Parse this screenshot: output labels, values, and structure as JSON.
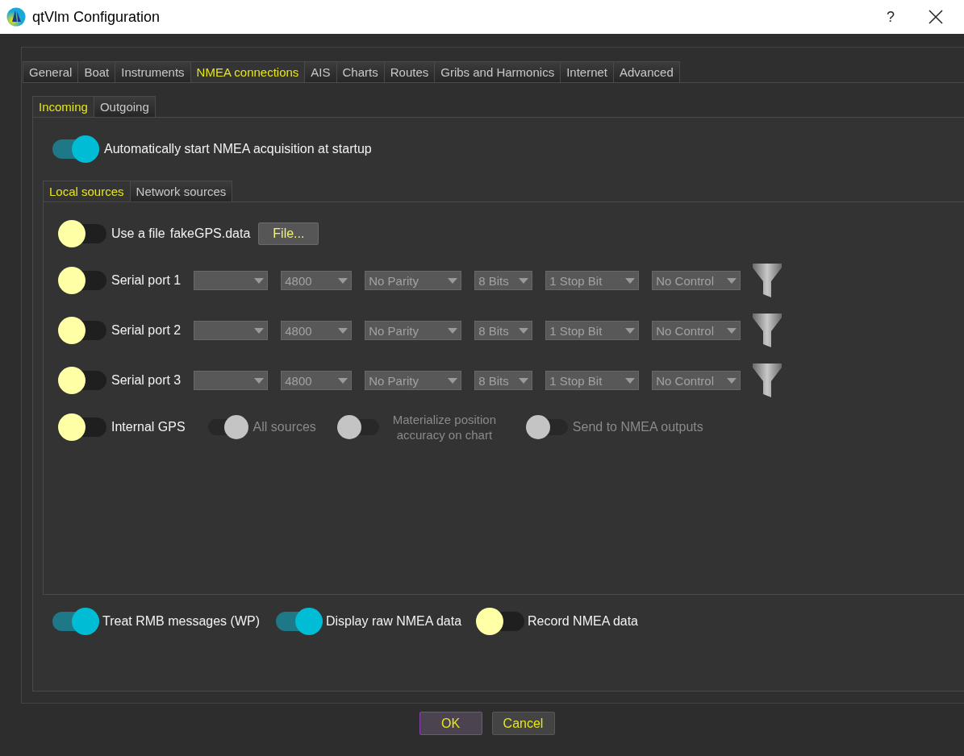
{
  "window": {
    "title": "qtVlm Configuration",
    "help_button": "?"
  },
  "tabs": [
    {
      "label": "General",
      "selected": false
    },
    {
      "label": "Boat",
      "selected": false
    },
    {
      "label": "Instruments",
      "selected": false
    },
    {
      "label": "NMEA connections",
      "selected": true
    },
    {
      "label": "AIS",
      "selected": false
    },
    {
      "label": "Charts",
      "selected": false
    },
    {
      "label": "Routes",
      "selected": false
    },
    {
      "label": "Gribs and Harmonics",
      "selected": false
    },
    {
      "label": "Internet",
      "selected": false
    },
    {
      "label": "Advanced",
      "selected": false
    }
  ],
  "subtabs": [
    {
      "label": "Incoming",
      "selected": true
    },
    {
      "label": "Outgoing",
      "selected": false
    }
  ],
  "auto_start": {
    "label": "Automatically start NMEA acquisition at startup",
    "on": true
  },
  "source_tabs": [
    {
      "label": "Local sources",
      "selected": true
    },
    {
      "label": "Network sources",
      "selected": false
    }
  ],
  "sources": [
    {
      "kind": "file",
      "label": "Use a file",
      "on": false,
      "file_name": "fakeGPS.data",
      "button": "File..."
    },
    {
      "kind": "serial",
      "label": "Serial port 1",
      "on": false,
      "combos": [
        {
          "kind": "port"
        },
        {
          "kind": "baud",
          "value": "4800"
        },
        {
          "kind": "parity",
          "value": "No Parity"
        },
        {
          "kind": "bits",
          "value": "8 Bits"
        },
        {
          "kind": "stop",
          "value": "1 Stop Bit"
        },
        {
          "kind": "flow",
          "value": "No Control"
        }
      ]
    },
    {
      "kind": "serial",
      "label": "Serial port 2",
      "on": false,
      "combos": [
        {
          "kind": "port"
        },
        {
          "kind": "baud",
          "value": "4800"
        },
        {
          "kind": "parity",
          "value": "No Parity"
        },
        {
          "kind": "bits",
          "value": "8 Bits"
        },
        {
          "kind": "stop",
          "value": "1 Stop Bit"
        },
        {
          "kind": "flow",
          "value": "No Control"
        }
      ]
    },
    {
      "kind": "serial",
      "label": "Serial port 3",
      "on": false,
      "combos": [
        {
          "kind": "port"
        },
        {
          "kind": "baud",
          "value": "4800"
        },
        {
          "kind": "parity",
          "value": "No Parity"
        },
        {
          "kind": "bits",
          "value": "8 Bits"
        },
        {
          "kind": "stop",
          "value": "1 Stop Bit"
        },
        {
          "kind": "flow",
          "value": "No Control"
        }
      ]
    },
    {
      "kind": "gps",
      "label": "Internal GPS",
      "on": false,
      "options": [
        {
          "label": "All sources",
          "on": true,
          "disabled": true
        },
        {
          "label": "Materialize position accuracy on chart",
          "on": false,
          "disabled": true
        },
        {
          "label": "Send to NMEA outputs",
          "on": false,
          "disabled": true
        }
      ]
    }
  ],
  "bottom_toggles": [
    {
      "label": "Treat RMB messages (WP)",
      "on": true
    },
    {
      "label": "Display raw NMEA data",
      "on": true
    },
    {
      "label": "Record NMEA data",
      "on": false
    }
  ],
  "buttons": [
    {
      "label": "OK",
      "default": true
    },
    {
      "label": "Cancel",
      "default": false
    }
  ]
}
